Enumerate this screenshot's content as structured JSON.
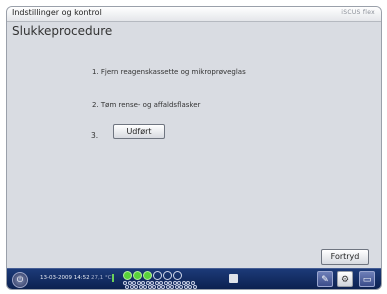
{
  "window": {
    "title": "Indstillinger og kontrol",
    "brand": "iSCUS flex"
  },
  "page": {
    "heading": "Slukkeprocedure"
  },
  "steps": [
    {
      "text": "1. Fjern reagenskassette og mikroprøveglas"
    },
    {
      "text": "2. Tøm rense- og affaldsflasker"
    },
    {
      "number": "3.",
      "button_label": "Udført"
    }
  ],
  "actions": {
    "cancel_label": "Fortryd"
  },
  "status_bar": {
    "datetime": "13-03-2009 14:52",
    "temperature": "27,1 °C",
    "active_circles": 3,
    "total_circles": 6,
    "icons": [
      "power-icon",
      "document-icon",
      "gear-icon",
      "folder-icon"
    ]
  },
  "colors": {
    "status_bar": "#0c2150",
    "active": "#5ad23a",
    "panel": "#d9dce2"
  }
}
